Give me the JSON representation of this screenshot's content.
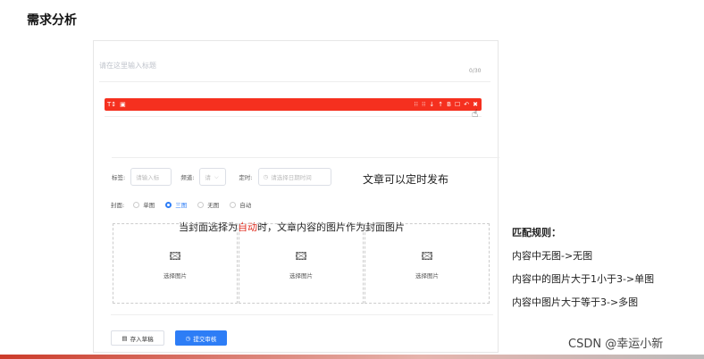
{
  "slide": {
    "title": "需求分析"
  },
  "editor": {
    "title_placeholder": "请在这里输入标题",
    "title_counter": "0/30",
    "toolbar": {
      "left_icons": [
        "T↕",
        "▣"
      ],
      "right_icons": [
        "⁝⁝",
        "⁝⁝",
        "↓",
        "↑",
        "B",
        "☐",
        "↶",
        "✖"
      ]
    }
  },
  "form": {
    "tag_label": "标签:",
    "tag_placeholder": "请输入标",
    "channel_label": "频道:",
    "channel_value": "请",
    "schedule_label": "定时:",
    "schedule_placeholder": "请选择日期时间",
    "cover_label": "封面:",
    "cover_options": [
      "单图",
      "三图",
      "无图",
      "自动"
    ],
    "cover_selected": "三图",
    "image_slot_label": "选择图片"
  },
  "buttons": {
    "draft": "存入草稿",
    "submit": "提交审核"
  },
  "annotations": {
    "schedule_note": "文章可以定时发布",
    "auto_note_prefix": "当封面选择为",
    "auto_note_highlight": "自动",
    "auto_note_suffix": "时，文章内容的图片作为封面图片"
  },
  "rules": {
    "title": "匹配规则：",
    "items": [
      "内容中无图->无图",
      "内容中的图片大于1小于3->单图",
      "内容中图片大于等于3->多图"
    ]
  },
  "watermark": "CSDN @幸运小新",
  "colors": {
    "toolbar_red": "#f5301f",
    "primary_blue": "#2d7df6",
    "highlight_red": "#e0291c"
  }
}
